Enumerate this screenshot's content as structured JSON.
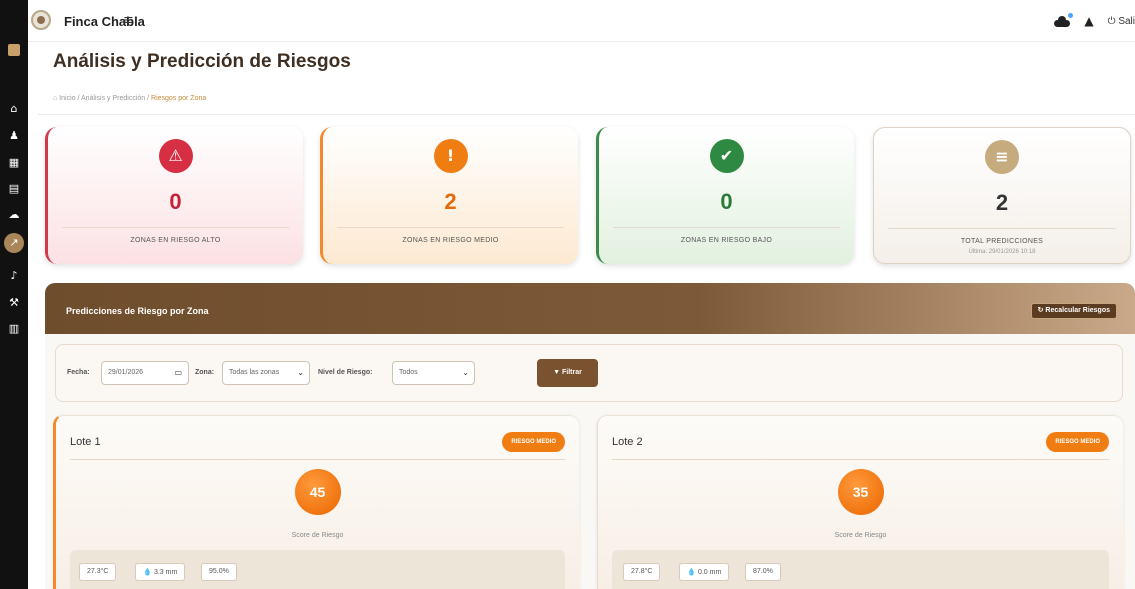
{
  "topbar": {
    "brand": "Finca Chabla",
    "menu_icon": "≡",
    "user_label": "⏻ Sali"
  },
  "page": {
    "title": "Análisis y Predicción de Riesgos",
    "breadcrumb": {
      "home": "⌂ Inicio",
      "sep1": " / ",
      "parent": "Análisis y Predicción",
      "sep2": " / ",
      "current": "Riesgos por Zona"
    }
  },
  "stats": {
    "high": {
      "icon": "⚠",
      "value": "0",
      "label": "ZONAS EN RIESGO ALTO"
    },
    "medium": {
      "icon": "!",
      "value": "2",
      "label": "ZONAS EN RIESGO MEDIO"
    },
    "low": {
      "icon": "✔",
      "value": "0",
      "label": "ZONAS EN RIESGO BAJO"
    },
    "total": {
      "icon": "≡",
      "value": "2",
      "label": "TOTAL PREDICCIONES",
      "sub": "Última: 29/01/2026 10:18"
    }
  },
  "section": {
    "title": "Predicciones de Riesgo por Zona",
    "recalc_label": "↻ Recalcular Riesgos"
  },
  "filters": {
    "date_label": "Fecha:",
    "date_value": "29/01/2026",
    "zone_label": "Zona:",
    "zone_value": "Todas las zonas",
    "level_label": "Nivel de Riesgo:",
    "level_value": "Todos",
    "filter_button": "▼ Filtrar"
  },
  "zones": [
    {
      "name": "Lote 1",
      "badge": "RIESGO MEDIO",
      "score": "45",
      "score_label": "Score de Riesgo",
      "temp": "27.3°C",
      "rain": "3.3 mm",
      "humidity": "95.0%"
    },
    {
      "name": "Lote 2",
      "badge": "RIESGO MEDIO",
      "score": "35",
      "score_label": "Score de Riesgo",
      "temp": "27.8°C",
      "rain": "0.0 mm",
      "humidity": "87.0%"
    }
  ],
  "colors": {
    "high": "#d62f43",
    "medium": "#f07d12",
    "low": "#2e8a42",
    "brand_brown": "#7a5230"
  }
}
